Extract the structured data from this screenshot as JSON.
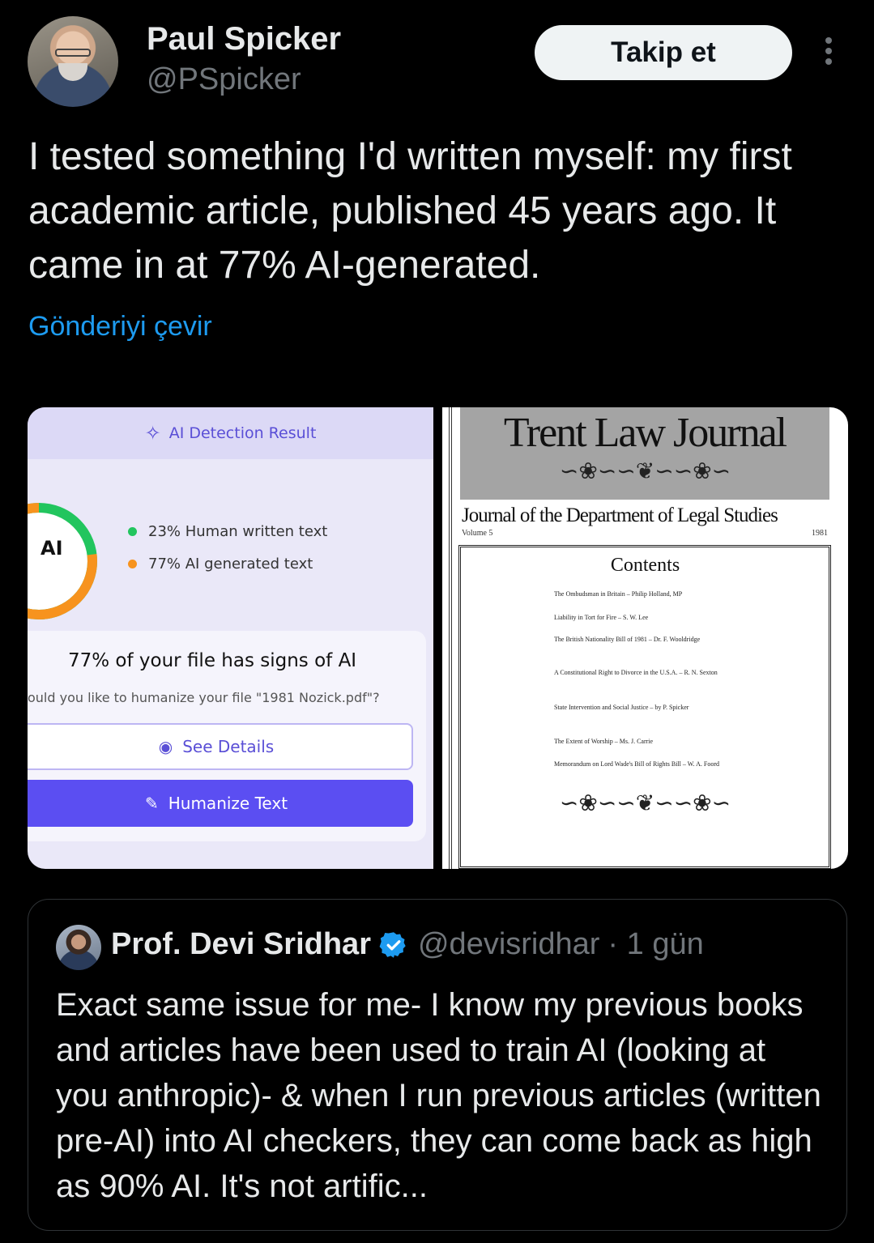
{
  "author": {
    "name": "Paul Spicker",
    "handle": "@PSpicker"
  },
  "follow_label": "Takip et",
  "tweet": {
    "text": "I tested something I'd written myself: my first academic article, published 45 years ago. It came in at 77% AI-generated.",
    "translate_label": "Gönderiyi çevir"
  },
  "image_left": {
    "header": "AI Detection Result",
    "ring_label": "AI",
    "legend": [
      {
        "text": "23% Human written text",
        "color": "#22c55e"
      },
      {
        "text": "77% AI generated text",
        "color": "#f7931e"
      }
    ],
    "ring_ai_fraction": 0.77,
    "card_title": "77% of your file has signs of AI",
    "card_subtitle": "ould you like to humanize your file \"1981 Nozick.pdf\"?",
    "see_details": "See Details",
    "humanize": "Humanize Text"
  },
  "image_right": {
    "journal_title": "Trent Law Journal",
    "department": "Journal of the Department of Legal Studies",
    "volume": "Volume 5",
    "year": "1981",
    "contents_heading": "Contents",
    "toc": [
      "The Ombudsman in Britain – Philip Holland, MP",
      "Liability in Tort for Fire – S. W. Lee",
      "The British Nationality Bill of 1981 – Dr. F. Wooldridge",
      "A Constitutional Right to Divorce in the U.S.A. – R. N. Sexton",
      "State Intervention and Social Justice – by P. Spicker",
      "The Extent of Worship – Ms. J. Carrie",
      "Memorandum on Lord Wade's Bill of Rights Bill – W. A. Foord"
    ]
  },
  "quoted": {
    "name": "Prof. Devi Sridhar",
    "handle": "@devisridhar",
    "time": "· 1 gün",
    "text": "Exact same issue for me- I know my previous books and articles have been used to train AI (looking at you anthropic)- & when I run previous articles (written pre-AI) into AI checkers, they can come back as high as 90% AI. It's not artific..."
  }
}
